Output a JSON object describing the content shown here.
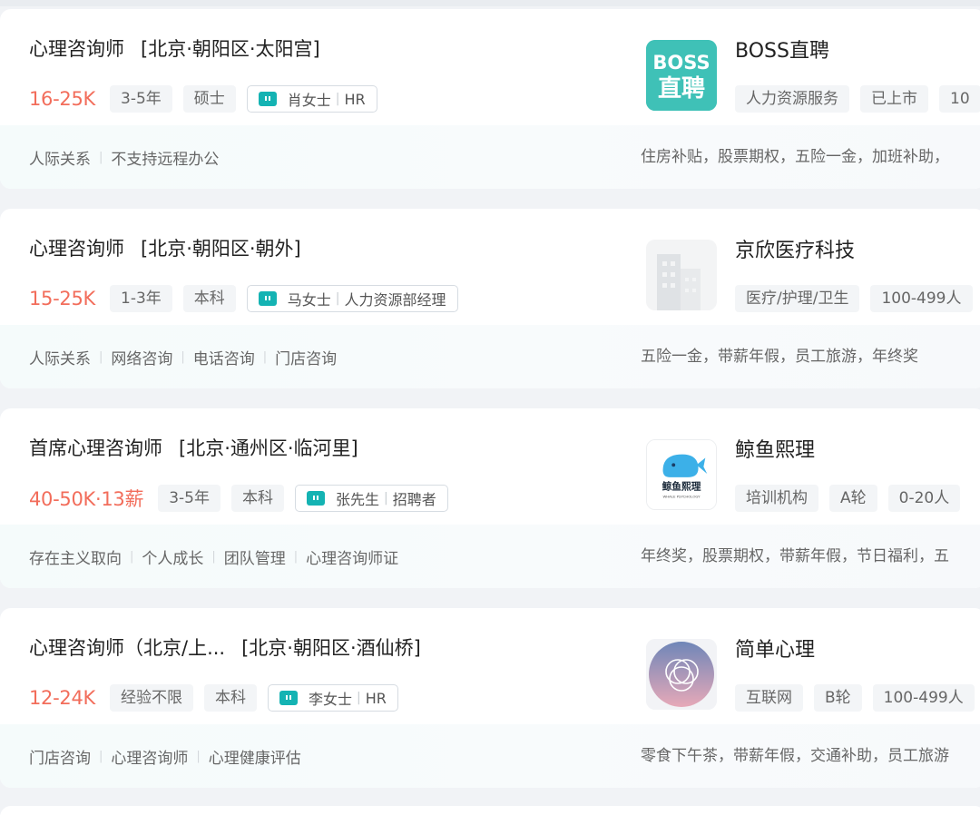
{
  "jobs": [
    {
      "title": "心理咨询师",
      "location": "[北京·朝阳区·太阳宫]",
      "salary": "16-25K",
      "tags": [
        "3-5年",
        "硕士"
      ],
      "recruiter": {
        "name": "肖女士",
        "role": "HR"
      },
      "company": {
        "name": "BOSS直聘",
        "tags": [
          "人力资源服务",
          "已上市",
          "10"
        ],
        "logo_text": [
          "BOSS",
          "直聘"
        ]
      },
      "skills": [
        "人际关系",
        "不支持远程办公"
      ],
      "benefits": "住房补贴，股票期权，五险一金，加班补助，"
    },
    {
      "title": "心理咨询师",
      "location": "[北京·朝阳区·朝外]",
      "salary": "15-25K",
      "tags": [
        "1-3年",
        "本科"
      ],
      "recruiter": {
        "name": "马女士",
        "role": "人力资源部经理"
      },
      "company": {
        "name": "京欣医疗科技",
        "tags": [
          "医疗/护理/卫生",
          "100-499人"
        ]
      },
      "skills": [
        "人际关系",
        "网络咨询",
        "电话咨询",
        "门店咨询"
      ],
      "benefits": "五险一金，带薪年假，员工旅游，年终奖"
    },
    {
      "title": "首席心理咨询师",
      "location": "[北京·通州区·临河里]",
      "salary": "40-50K·13薪",
      "tags": [
        "3-5年",
        "本科"
      ],
      "recruiter": {
        "name": "张先生",
        "role": "招聘者"
      },
      "company": {
        "name": "鲸鱼熙理",
        "tags": [
          "培训机构",
          "A轮",
          "0-20人"
        ],
        "logo_text": [
          "鲸鱼熙理",
          "WHALE PSYCHOLOGY"
        ]
      },
      "skills": [
        "存在主义取向",
        "个人成长",
        "团队管理",
        "心理咨询师证"
      ],
      "benefits": "年终奖，股票期权，带薪年假，节日福利，五"
    },
    {
      "title": "心理咨询师（北京/上...",
      "location": "[北京·朝阳区·酒仙桥]",
      "salary": "12-24K",
      "tags": [
        "经验不限",
        "本科"
      ],
      "recruiter": {
        "name": "李女士",
        "role": "HR"
      },
      "company": {
        "name": "简单心理",
        "tags": [
          "互联网",
          "B轮",
          "100-499人"
        ]
      },
      "skills": [
        "门店咨询",
        "心理咨询师",
        "心理健康评估"
      ],
      "benefits": "零食下午茶，带薪年假，交通补助，员工旅游"
    }
  ],
  "colors": {
    "salary": "#f26d5b",
    "accent": "#14b3b3",
    "boss_logo": "#3fc1b7"
  }
}
